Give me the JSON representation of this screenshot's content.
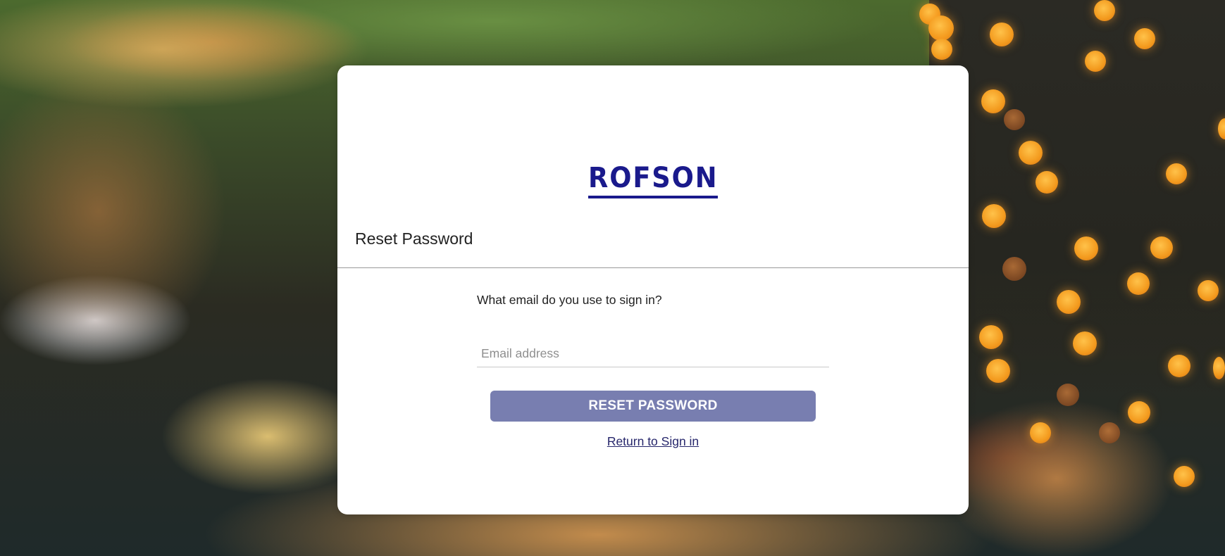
{
  "brand": {
    "logo_text": "ROFSON",
    "logo_color": "#1a1a8c"
  },
  "card": {
    "title": "Reset Password"
  },
  "form": {
    "prompt": "What email do you use to sign in?",
    "email_placeholder": "Email address",
    "email_value": "",
    "submit_label": "RESET PASSWORD",
    "submit_color": "#787eb0",
    "return_link_label": "Return to Sign in",
    "return_link_color": "#26266b"
  }
}
